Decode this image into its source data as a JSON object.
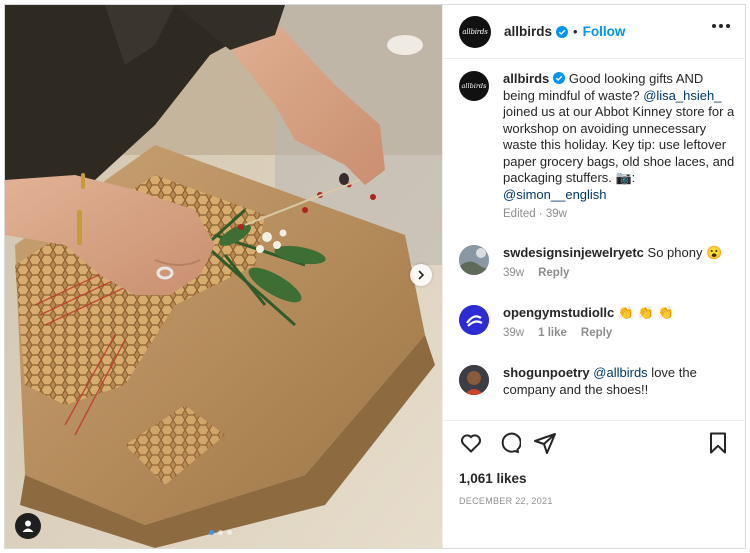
{
  "post": {
    "username": "allbirds",
    "avatar_text": "allbirds",
    "follow_label": "Follow",
    "separator": "•",
    "verified_icon": "verified-badge-icon",
    "more_icon": "more-horizontal-icon",
    "carousel": {
      "slides": 3,
      "active_index": 0
    },
    "caption": {
      "username": "allbirds",
      "parts": [
        {
          "type": "text",
          "value": " Good looking gifts AND being mindful of waste? "
        },
        {
          "type": "mention",
          "value": "@lisa_hsieh_"
        },
        {
          "type": "text",
          "value": " joined us at our Abbot Kinney store for a workshop on avoiding unnecessary waste this holiday. Key tip: use leftover paper grocery bags, old shoe laces, and packaging stuffers. 📷: "
        },
        {
          "type": "mention",
          "value": "@simon__english"
        }
      ],
      "meta": "Edited · 39w"
    },
    "comments": [
      {
        "username": "swdesignsinjewelryetc",
        "text": " So phony 😮",
        "time": "39w",
        "likes": "",
        "reply": "Reply",
        "avatar_color": "#a9b3bd"
      },
      {
        "username": "opengymstudiollc",
        "text": " 👏 👏 👏",
        "time": "39w",
        "likes": "1 like",
        "reply": "Reply",
        "avatar_color": "#2c2bd6"
      },
      {
        "username": "shogunpoetry",
        "mention": "@allbirds",
        "text": " love the company and the shoes!!",
        "time": "",
        "likes": "",
        "reply": "",
        "avatar_color": "#6b4a3a"
      }
    ],
    "actions": {
      "like_icon": "heart-icon",
      "comment_icon": "comment-icon",
      "share_icon": "send-icon",
      "save_icon": "bookmark-icon"
    },
    "likes": "1,061 likes",
    "date": "DECEMBER 22, 2021"
  }
}
